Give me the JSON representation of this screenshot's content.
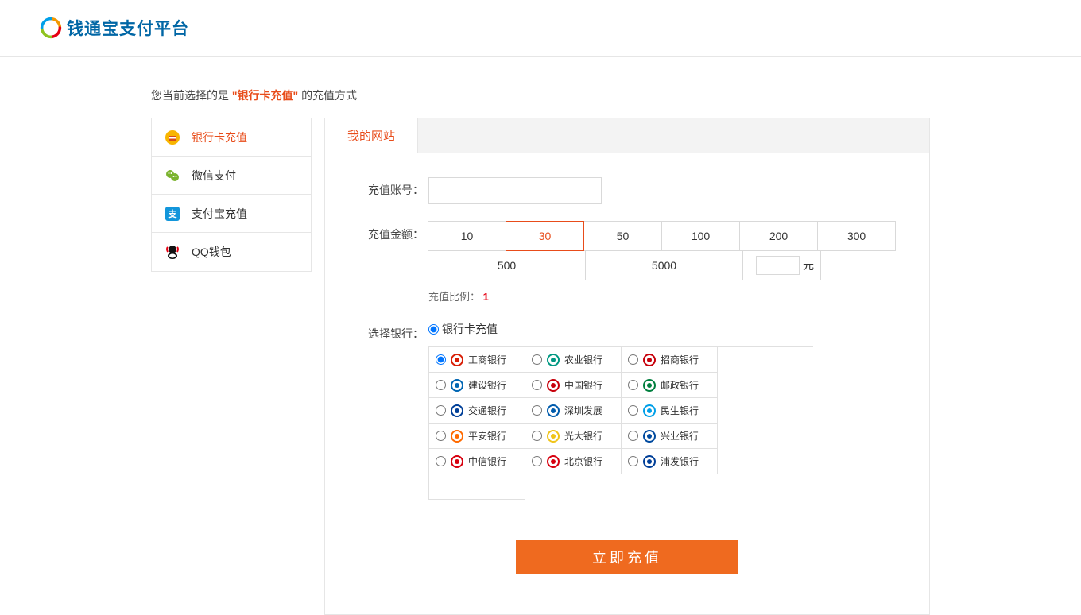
{
  "header": {
    "brand": "钱通宝支付平台"
  },
  "notice": {
    "prefix": "您当前选择的是",
    "highlight": "\"银行卡充值\"",
    "suffix": "的充值方式"
  },
  "sidebar": {
    "items": [
      {
        "label": "银行卡充值",
        "active": true
      },
      {
        "label": "微信支付",
        "active": false
      },
      {
        "label": "支付宝充值",
        "active": false
      },
      {
        "label": "QQ钱包",
        "active": false
      }
    ]
  },
  "tabs": {
    "active": "我的网站"
  },
  "form": {
    "account_label": "充值账号：",
    "account_value": "",
    "amount_label": "充值金额：",
    "amounts": [
      "10",
      "30",
      "50",
      "100",
      "200",
      "300",
      "500",
      "5000"
    ],
    "selected_amount": "30",
    "custom_unit": "元",
    "custom_value": "",
    "ratio_label": "充值比例：",
    "ratio_value": "1",
    "bank_section_label": "选择银行：",
    "bank_method_option": "银行卡充值",
    "banks": [
      {
        "name": "工商银行",
        "color": "#d81e06"
      },
      {
        "name": "农业银行",
        "color": "#009882"
      },
      {
        "name": "招商银行",
        "color": "#c7000b"
      },
      {
        "name": "建设银行",
        "color": "#0066b3"
      },
      {
        "name": "中国银行",
        "color": "#c7000b"
      },
      {
        "name": "邮政银行",
        "color": "#007f3e"
      },
      {
        "name": "交通银行",
        "color": "#003f98"
      },
      {
        "name": "深圳发展",
        "color": "#005bac"
      },
      {
        "name": "民生银行",
        "color": "#009fe8"
      },
      {
        "name": "平安银行",
        "color": "#ff6a00"
      },
      {
        "name": "光大银行",
        "color": "#f0c419"
      },
      {
        "name": "兴业银行",
        "color": "#004a9f"
      },
      {
        "name": "中信银行",
        "color": "#d7000f"
      },
      {
        "name": "北京银行",
        "color": "#d7000f"
      },
      {
        "name": "浦发银行",
        "color": "#003f98"
      }
    ],
    "selected_bank": "工商银行",
    "submit_label": "立即充值"
  }
}
